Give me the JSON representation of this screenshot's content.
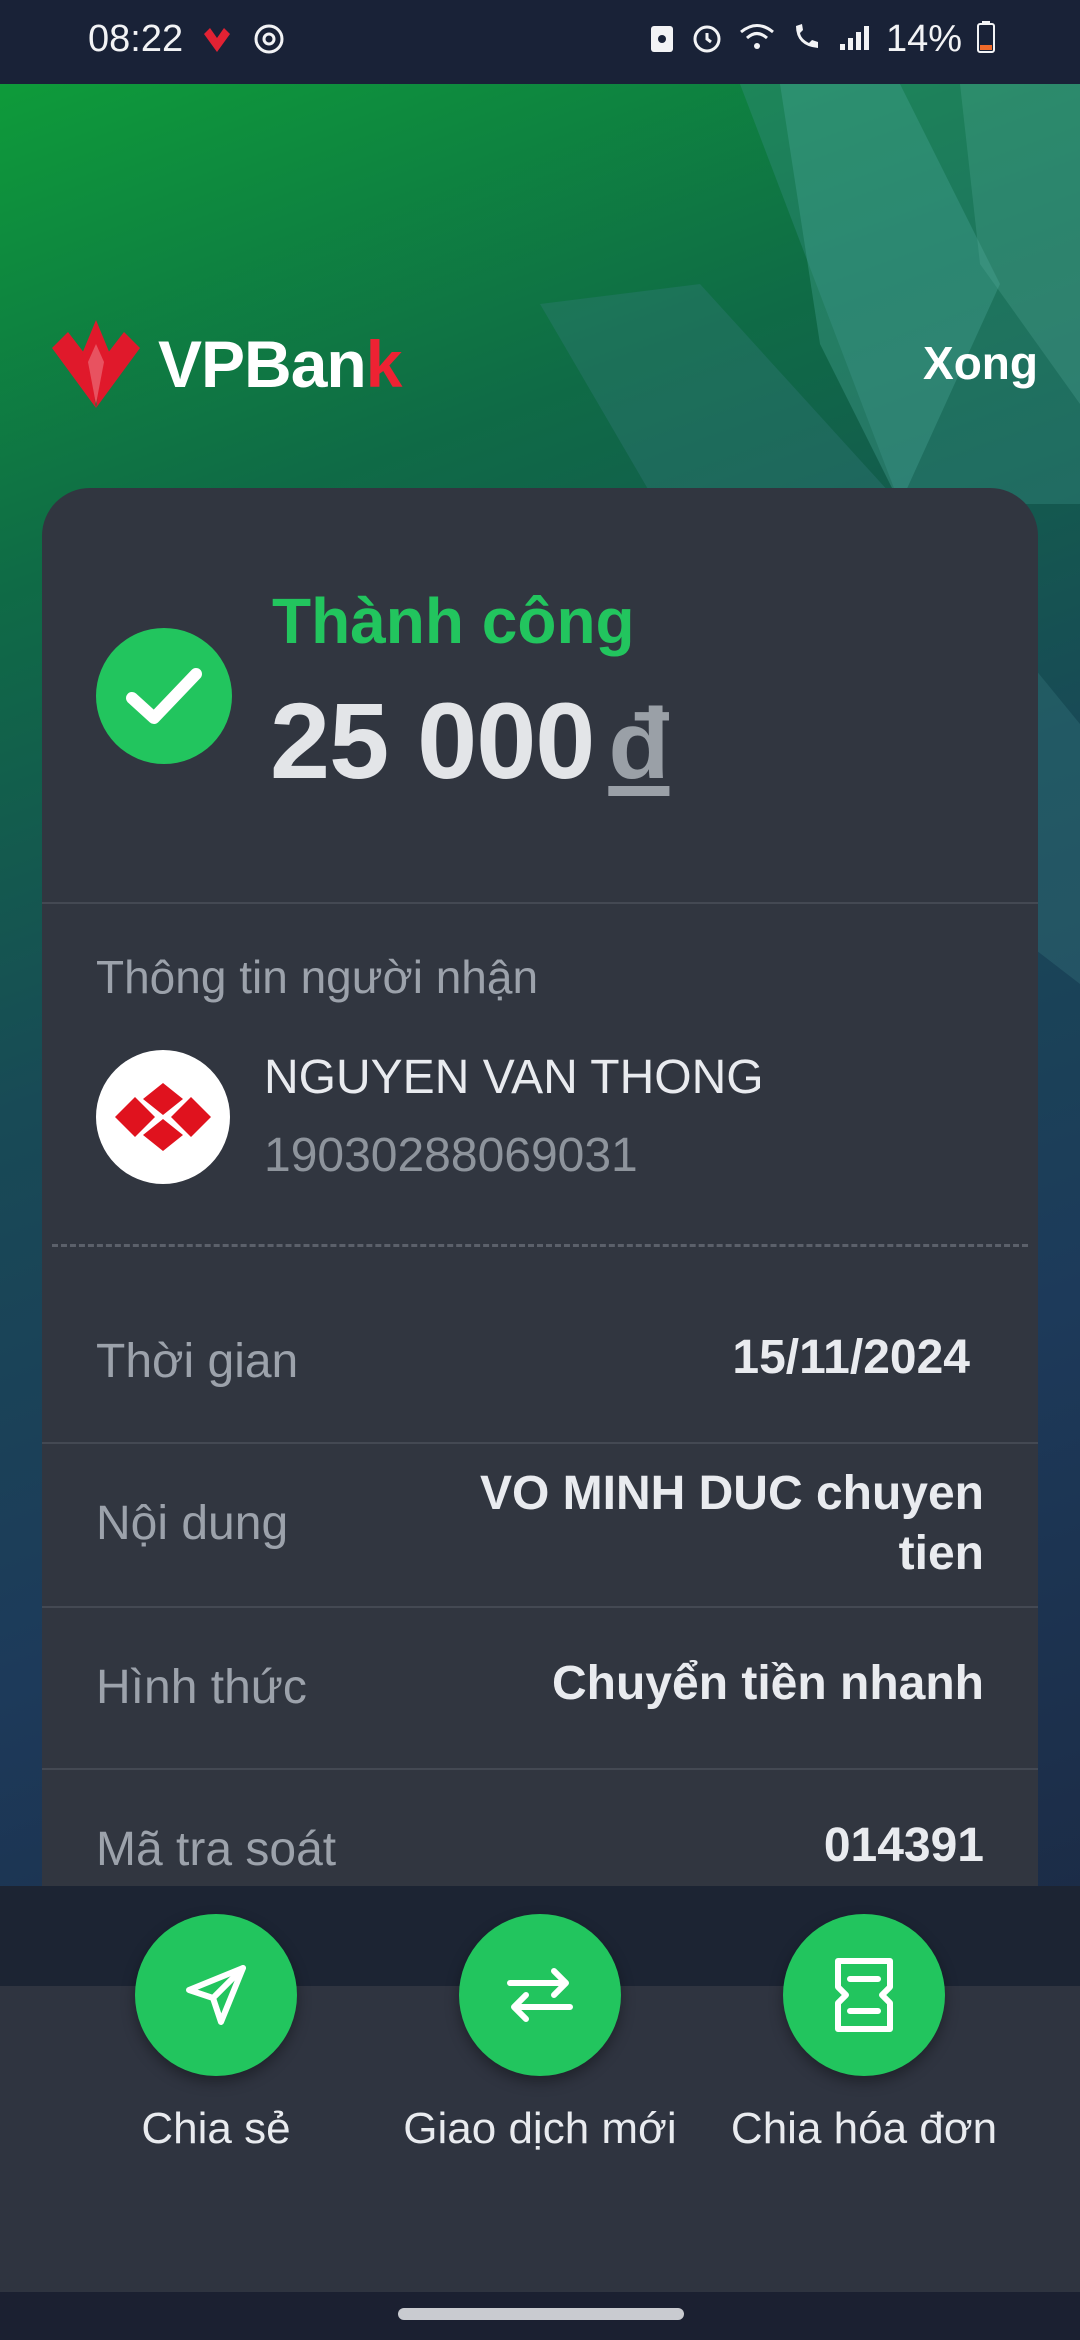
{
  "status_bar": {
    "time": "08:22",
    "battery": "14%"
  },
  "header": {
    "brand": "VPBan",
    "brand_suffix": "k",
    "done_label": "Xong"
  },
  "result": {
    "status": "Thành công",
    "amount": "25 000",
    "currency": "đ"
  },
  "recipient": {
    "section_label": "Thông tin người nhận",
    "name": "NGUYEN VAN THONG",
    "account": "19030288069031"
  },
  "details": {
    "time_label": "Thời gian",
    "time_value": "15/11/2024",
    "content_label": "Nội dung",
    "content_value": "VO MINH DUC chuyen tien",
    "method_label": "Hình thức",
    "method_value": "Chuyển tiền nhanh",
    "trace_label": "Mã tra soát",
    "trace_value": "014391"
  },
  "actions": {
    "share": "Chia sẻ",
    "new_transaction": "Giao dịch mới",
    "split_bill": "Chia hóa đơn"
  },
  "colors": {
    "success_green": "#22c55e",
    "card_bg": "#313640",
    "brand_red": "#ee2233"
  }
}
